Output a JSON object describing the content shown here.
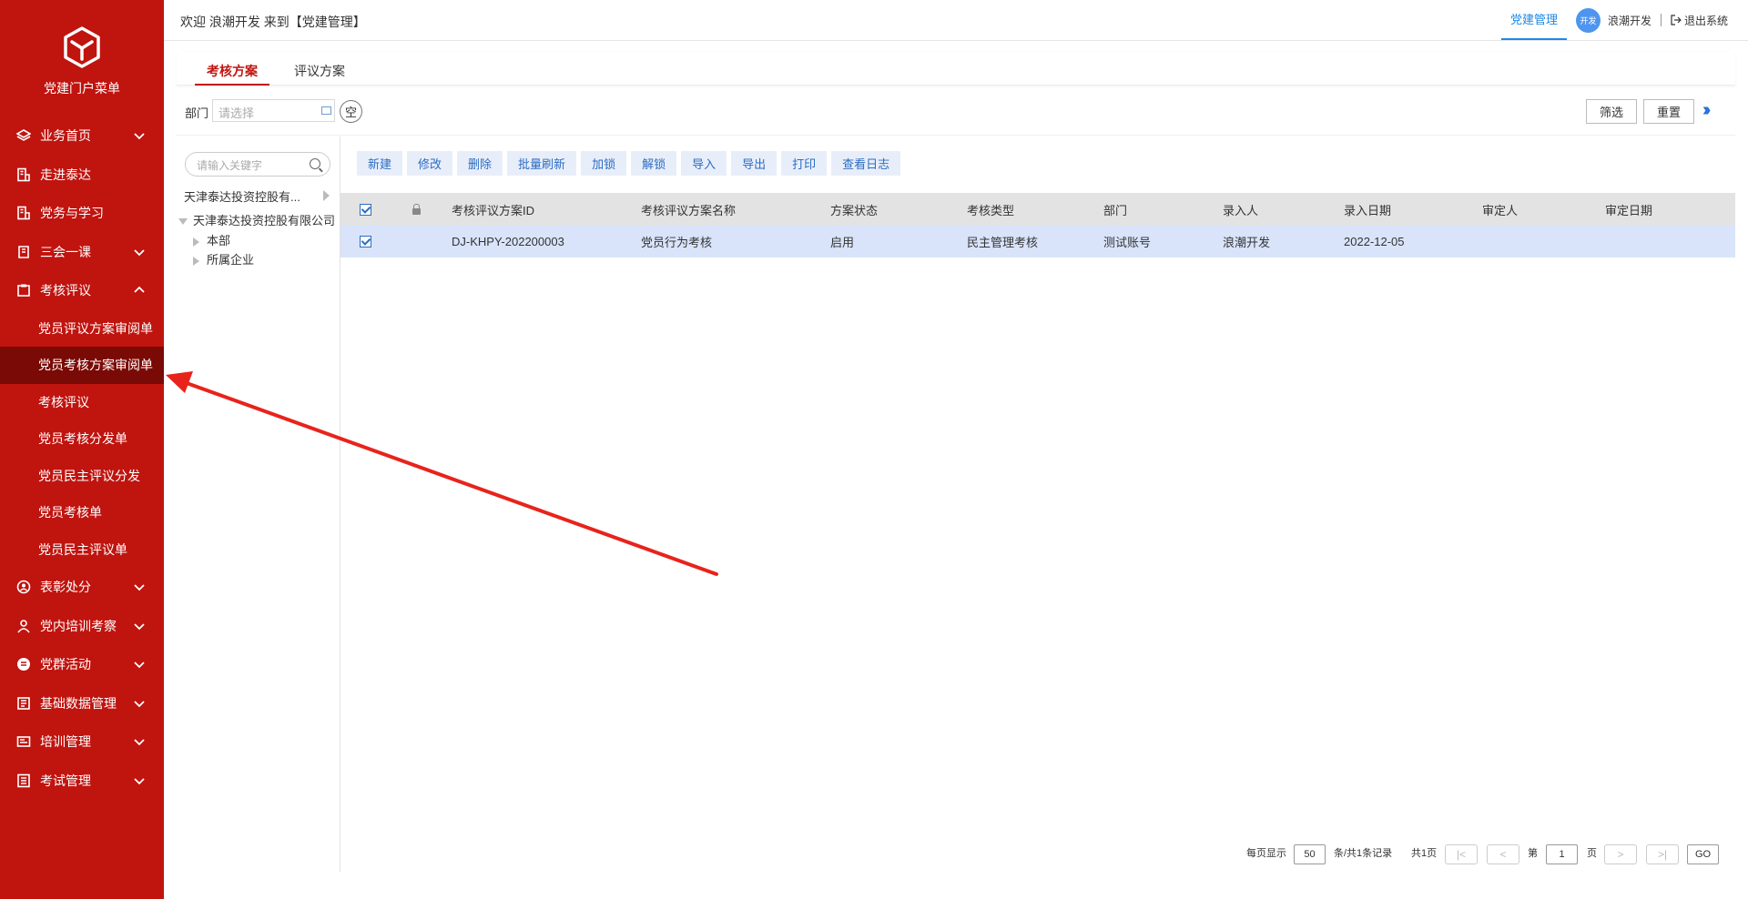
{
  "sidebar": {
    "logo_text": "党建门户菜单",
    "items": [
      {
        "label": "业务首页",
        "icon": "layers-icon",
        "chevron": "down"
      },
      {
        "label": "走进泰达",
        "icon": "building-icon",
        "chevron": ""
      },
      {
        "label": "党务与学习",
        "icon": "building-icon",
        "chevron": ""
      },
      {
        "label": "三会一课",
        "icon": "book-icon",
        "chevron": "down"
      },
      {
        "label": "考核评议",
        "icon": "clipboard-icon",
        "chevron": "up"
      }
    ],
    "sub_items": [
      {
        "label": "党员评议方案审阅单",
        "active": false
      },
      {
        "label": "党员考核方案审阅单",
        "active": true
      },
      {
        "label": "考核评议",
        "active": false
      },
      {
        "label": "党员考核分发单",
        "active": false
      },
      {
        "label": "党员民主评议分发",
        "active": false
      },
      {
        "label": "党员考核单",
        "active": false
      },
      {
        "label": "党员民主评议单",
        "active": false
      }
    ],
    "items_after": [
      {
        "label": "表彰处分",
        "icon": "user-circle-icon",
        "chevron": "down"
      },
      {
        "label": "党内培训考察",
        "icon": "user-icon",
        "chevron": "down"
      },
      {
        "label": "党群活动",
        "icon": "coin-icon",
        "chevron": "down"
      },
      {
        "label": "基础数据管理",
        "icon": "database-icon",
        "chevron": "down"
      },
      {
        "label": "培训管理",
        "icon": "training-icon",
        "chevron": "down"
      },
      {
        "label": "考试管理",
        "icon": "exam-icon",
        "chevron": "down"
      }
    ]
  },
  "topbar": {
    "welcome": "欢迎 浪潮开发 来到【党建管理】",
    "module": "党建管理",
    "avatar_text": "开发",
    "user": "浪潮开发",
    "logout": "退出系统"
  },
  "tabs": [
    {
      "label": "考核方案",
      "active": true
    },
    {
      "label": "评议方案",
      "active": false
    }
  ],
  "filter": {
    "dept_label": "部门",
    "dept_placeholder": "请选择",
    "clear_label": "空",
    "filter_btn": "筛选",
    "reset_btn": "重置"
  },
  "tree": {
    "search_placeholder": "请输入关键字",
    "header": "天津泰达投资控股有...",
    "root": "天津泰达投资控股有限公司",
    "children": [
      "本部",
      "所属企业"
    ]
  },
  "toolbar": [
    "新建",
    "修改",
    "删除",
    "批量刷新",
    "加锁",
    "解锁",
    "导入",
    "导出",
    "打印",
    "查看日志"
  ],
  "table": {
    "columns": [
      "考核评议方案ID",
      "考核评议方案名称",
      "方案状态",
      "考核类型",
      "部门",
      "录入人",
      "录入日期",
      "审定人",
      "审定日期"
    ],
    "rows": [
      [
        "DJ-KHPY-202200003",
        "党员行为考核",
        "启用",
        "民主管理考核",
        "测试账号",
        "浪潮开发",
        "2022-12-05",
        "",
        ""
      ]
    ]
  },
  "pager": {
    "per_page_label": "每页显示",
    "per_page": "50",
    "records": "条/共1条记录",
    "total_pages": "共1页",
    "page_label": "第",
    "page": "1",
    "page_suffix": "页",
    "go": "GO"
  },
  "colors": {
    "sidebar_bg": "#c0140f",
    "sidebar_active": "#7a0a05",
    "accent_blue": "#1e88e5",
    "tab_active": "#c0140f",
    "toolbar_btn_bg": "#e8eef9",
    "row_selected": "#d9e4fb",
    "annotation_arrow": "#e8231c"
  }
}
